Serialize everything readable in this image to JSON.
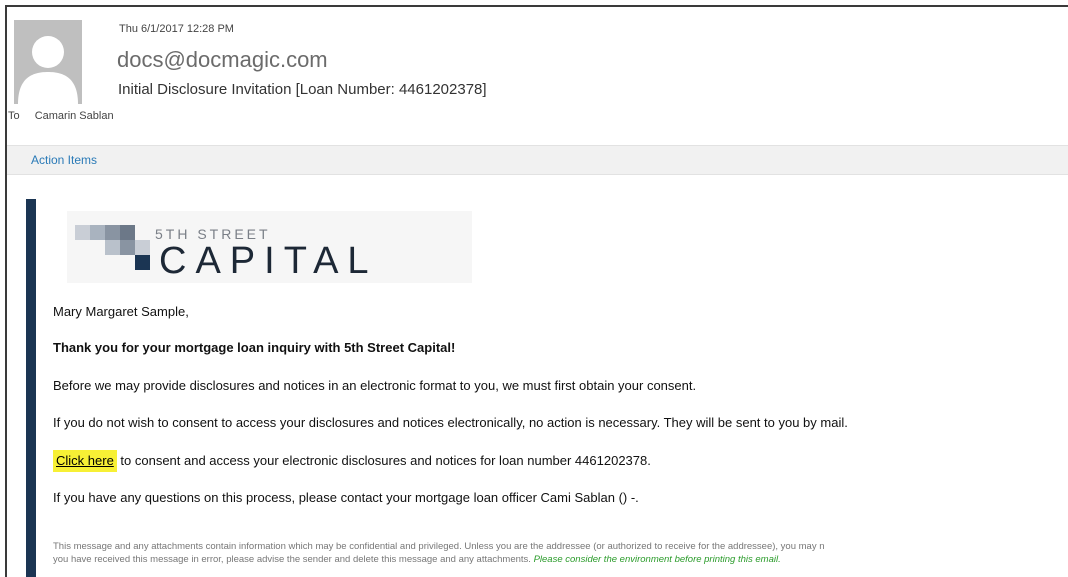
{
  "header": {
    "date": "Thu 6/1/2017 12:28 PM",
    "from": "docs@docmagic.com",
    "subject": "Initial Disclosure Invitation [Loan Number: 4461202378]",
    "to_label": "To",
    "to_name": "Camarin Sablan"
  },
  "action_items": "Action Items",
  "logo": {
    "line1": "5TH STREET",
    "line2": "CAPITAL"
  },
  "message": {
    "greeting": "Mary Margaret Sample,",
    "thanks": "Thank you for your mortgage loan inquiry with 5th Street Capital!",
    "consent_intro": "Before we may provide disclosures and notices in an electronic format to you, we must first obtain your consent.",
    "no_consent": "If you do not wish to consent to access your disclosures and notices electronically, no action is necessary. They will be sent to you by mail.",
    "link_text": "Click here",
    "link_rest": " to consent and access your electronic disclosures and notices for loan number 4461202378.",
    "questions": "If you have any questions on this process, please contact your mortgage loan officer Cami Sablan () -.",
    "footer_line1": "This message and any attachments contain information which may be confidential and privileged. Unless you are the addressee (or authorized to receive for the addressee), you may n",
    "footer_line2": "you have received this message in error, please advise the sender and delete this message and any attachments.",
    "footer_green": "Please consider the environment before printing this email."
  },
  "colors": {
    "accent_bar": "#1b3553",
    "link_highlight": "#f7f035",
    "action_link": "#2a7ab7",
    "eco_green": "#2a9b2a"
  }
}
